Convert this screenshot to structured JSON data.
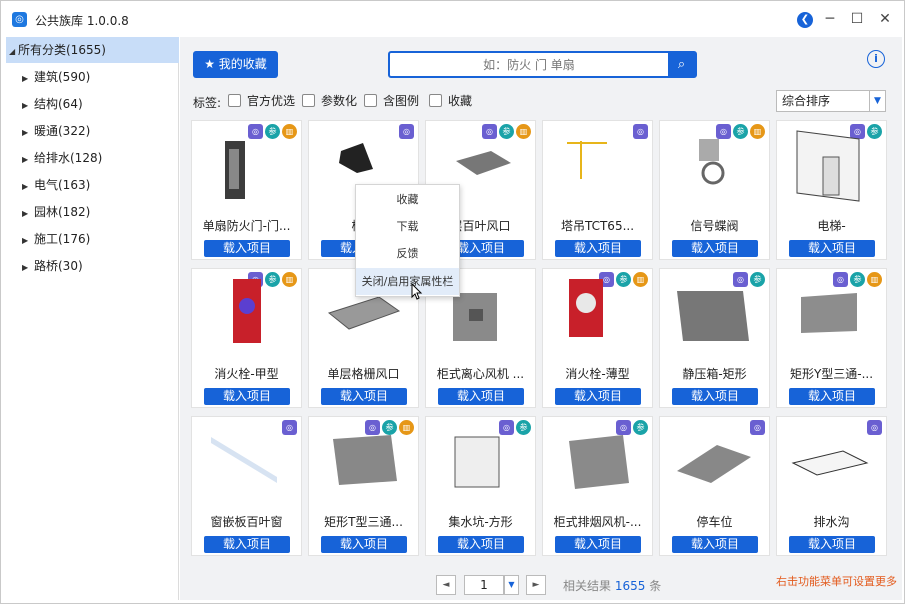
{
  "window": {
    "title": "公共族库 1.0.0.8",
    "controls": {
      "minimize": "─",
      "maximize": "☐",
      "close": "✕"
    }
  },
  "sidebar": {
    "items": [
      {
        "label": "所有分类(1655)",
        "expanded": true,
        "selected": true
      },
      {
        "label": "建筑(590)"
      },
      {
        "label": "结构(64)"
      },
      {
        "label": "暖通(322)"
      },
      {
        "label": "给排水(128)"
      },
      {
        "label": "电气(163)"
      },
      {
        "label": "园林(182)"
      },
      {
        "label": "施工(176)"
      },
      {
        "label": "路桥(30)"
      }
    ]
  },
  "toolbar": {
    "favorites_label": "我的收藏",
    "search_placeholder": "如：防火 门 单扇",
    "search_value": ""
  },
  "filters": {
    "label": "标签:",
    "options": [
      "官方优选",
      "参数化",
      "含图例",
      "收藏"
    ],
    "sort_value": "综合排序"
  },
  "cards": [
    {
      "name": "单扇防火门-门...",
      "badges": [
        "b",
        "g",
        "o"
      ],
      "button": "载入项目"
    },
    {
      "name": "椅子",
      "badges": [
        "b"
      ],
      "button": "载入项目"
    },
    {
      "name": "层百叶风口",
      "badges": [
        "b",
        "g",
        "o"
      ],
      "button": "载入项目"
    },
    {
      "name": "塔吊TCT65...",
      "badges": [
        "b"
      ],
      "button": "载入项目"
    },
    {
      "name": "信号蝶阀",
      "badges": [
        "b",
        "g",
        "o"
      ],
      "button": "载入项目"
    },
    {
      "name": "电梯-",
      "badges": [
        "b",
        "g"
      ],
      "button": "载入项目"
    },
    {
      "name": "消火栓-甲型",
      "badges": [
        "b",
        "g",
        "o"
      ],
      "button": "载入项目"
    },
    {
      "name": "单层格栅风口",
      "badges": [],
      "button": "载入项目"
    },
    {
      "name": "柜式离心风机 ...",
      "badges": [],
      "button": "载入项目"
    },
    {
      "name": "消火栓-薄型",
      "badges": [
        "b",
        "g",
        "o"
      ],
      "button": "载入项目"
    },
    {
      "name": "静压箱-矩形",
      "badges": [
        "b",
        "g"
      ],
      "button": "载入项目"
    },
    {
      "name": "矩形Y型三通-...",
      "badges": [
        "b",
        "g",
        "o"
      ],
      "button": "载入项目"
    },
    {
      "name": "窗嵌板百叶窗",
      "badges": [
        "b"
      ],
      "button": "载入项目"
    },
    {
      "name": "矩形T型三通...",
      "badges": [
        "b",
        "g",
        "o"
      ],
      "button": "载入项目"
    },
    {
      "name": "集水坑-方形",
      "badges": [
        "b",
        "g"
      ],
      "button": "载入项目"
    },
    {
      "name": "柜式排烟风机-...",
      "badges": [
        "b",
        "g"
      ],
      "button": "载入项目"
    },
    {
      "name": "停车位",
      "badges": [
        "b"
      ],
      "button": "载入项目"
    },
    {
      "name": "排水沟",
      "badges": [
        "b"
      ],
      "button": "载入项目"
    }
  ],
  "context_menu": {
    "items": [
      "收藏",
      "下载",
      "反馈",
      "关闭/启用家属性栏"
    ]
  },
  "pagination": {
    "page": "1",
    "result_prefix": "相关结果",
    "result_count": "1655",
    "result_suffix": "条"
  },
  "hint": "右击功能菜单可设置更多",
  "colors": {
    "accent": "#1763d8",
    "hint": "#e35a1c",
    "selected": "#c8ddf8"
  }
}
